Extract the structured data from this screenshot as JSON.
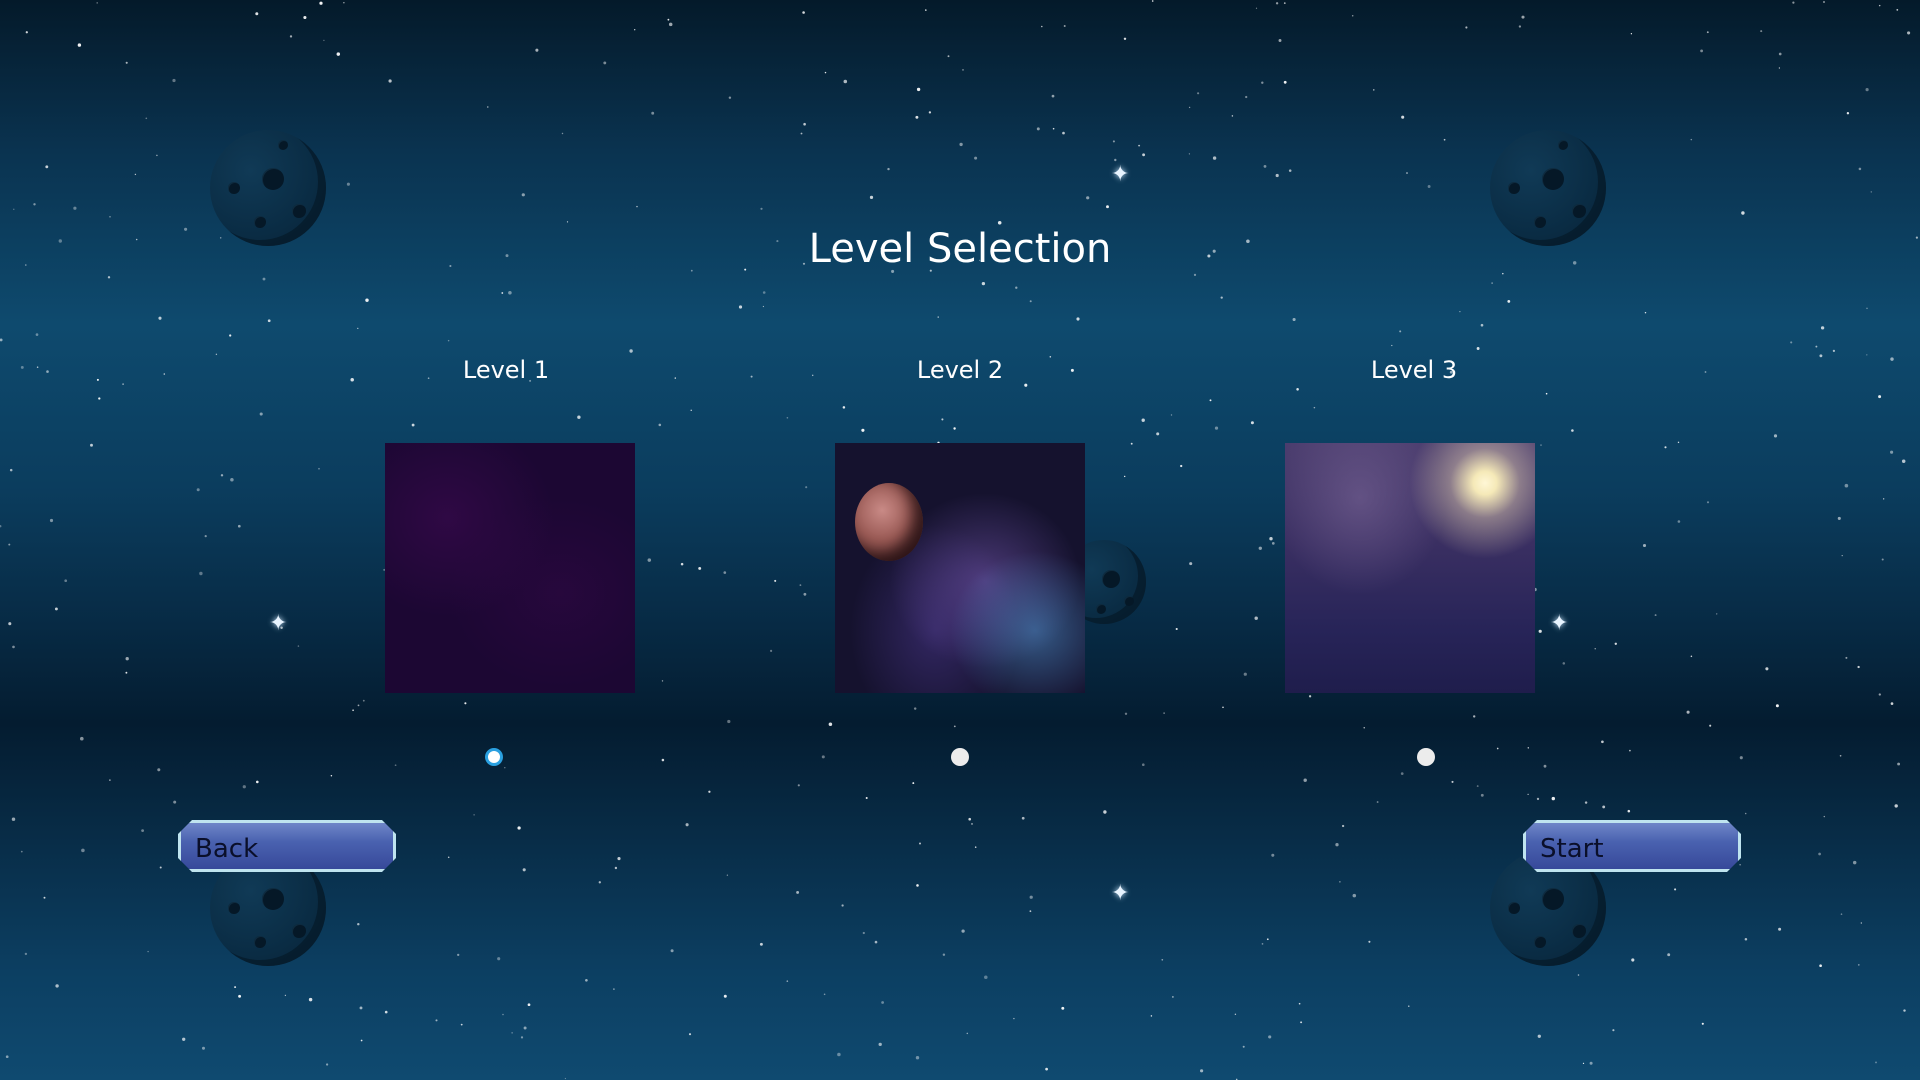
{
  "screen": {
    "title": "Level Selection"
  },
  "levels": [
    {
      "label": "Level 1",
      "selected": true
    },
    {
      "label": "Level 2",
      "selected": false
    },
    {
      "label": "Level 3",
      "selected": false
    }
  ],
  "buttons": {
    "back_label": "Back",
    "start_label": "Start"
  },
  "colors": {
    "sky_top": "#041a2a",
    "sky_band": "#0e4a6e",
    "button_fill": "#4a62b0",
    "button_border": "#bfe4ef",
    "radio_selected_ring": "#2aa0e0"
  }
}
